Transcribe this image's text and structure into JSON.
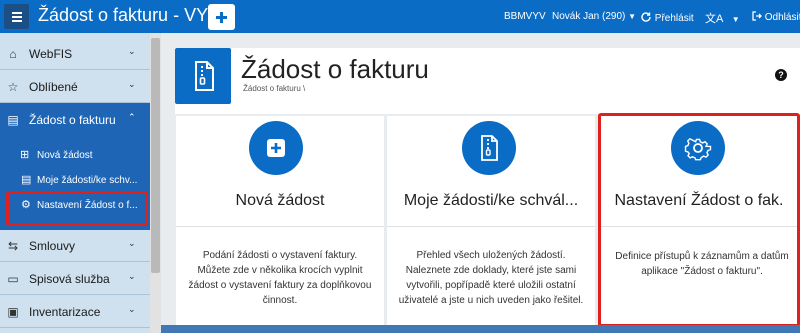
{
  "app": {
    "title": "Žádost o fakturu - VYV",
    "org": "BBMVYV",
    "user": "Novák Jan (290)",
    "switch_label": "Přehlásit",
    "logout_label": "Odhlásit",
    "accent": "#0b6cc6"
  },
  "sidebar": {
    "items": [
      {
        "label": "WebFIS",
        "icon": "home-icon"
      },
      {
        "label": "Oblíbené",
        "icon": "star-icon"
      },
      {
        "label": "Žádost o fakturu",
        "icon": "document-icon",
        "active": true
      },
      {
        "label": "Smlouvy",
        "icon": "handshake-icon"
      },
      {
        "label": "Spisová služba",
        "icon": "folder-icon"
      },
      {
        "label": "Inventarizace",
        "icon": "clipboard-icon"
      }
    ],
    "subitems": [
      {
        "label": "Nová žádost",
        "icon": "plus-square-icon"
      },
      {
        "label": "Moje žádosti/ke schv...",
        "icon": "document-icon"
      },
      {
        "label": "Nastavení Žádost o f...",
        "icon": "gear-icon"
      }
    ]
  },
  "page": {
    "title": "Žádost o fakturu",
    "breadcrumb": "Žádost o fakturu  \\"
  },
  "cards": [
    {
      "title": "Nová žádost",
      "icon": "plus-square-icon",
      "description": "Podání žádosti o vystavení faktury. Můžete zde v několika krocích vyplnit žádost o vystavení faktury za doplňkovou činnost."
    },
    {
      "title": "Moje žádosti/ke schvál...",
      "icon": "document-icon",
      "description": "Přehled všech uložených žádostí. Naleznete zde doklady, které jste sami vytvořili, popřípadě které uložili ostatní uživatelé a jste u nich uveden jako řešitel."
    },
    {
      "title": "Nastavení Žádost o fak.",
      "icon": "gear-icon",
      "description": "Definice přístupů k záznamům a datům aplikace \"Žádost o fakturu\"."
    }
  ]
}
